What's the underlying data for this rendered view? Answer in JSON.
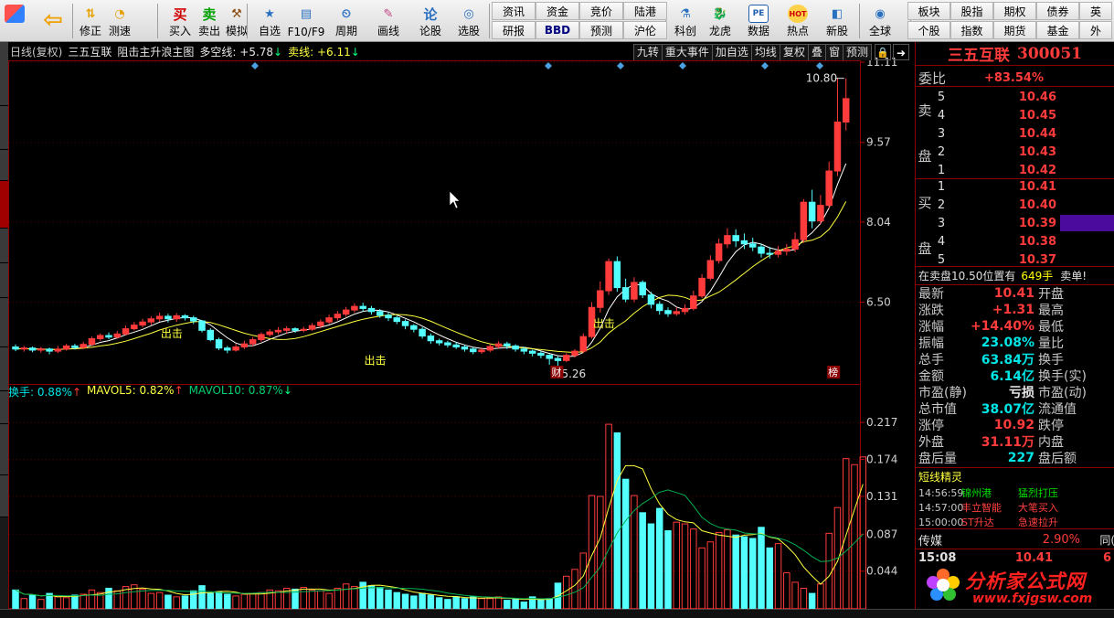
{
  "toolbar": {
    "buttons": [
      {
        "label": "修正",
        "icon": "up-down-arrows-icon"
      },
      {
        "label": "测速",
        "icon": "gauge-icon"
      },
      {
        "label": "买入",
        "icon": "buy-icon",
        "glyph": "买"
      },
      {
        "label": "卖出",
        "icon": "sell-icon",
        "glyph": "卖"
      },
      {
        "label": "模拟",
        "icon": "hammer-icon"
      },
      {
        "label": "自选",
        "icon": "star-folder-icon"
      },
      {
        "label": "F10/F9",
        "icon": "f10-icon"
      },
      {
        "label": "周期",
        "icon": "period-icon"
      },
      {
        "label": "画线",
        "icon": "pencil-icon"
      },
      {
        "label": "论股",
        "icon": "discuss-icon",
        "glyph": "论"
      },
      {
        "label": "选股",
        "icon": "pick-stock-icon"
      },
      {
        "label": "科创",
        "icon": "science-icon"
      },
      {
        "label": "龙虎",
        "icon": "dragon-tiger-icon"
      },
      {
        "label": "数据",
        "icon": "data-pe-icon",
        "glyph": "PE"
      },
      {
        "label": "热点",
        "icon": "hotspot-icon",
        "glyph": "HOT"
      },
      {
        "label": "新股",
        "icon": "new-stock-icon"
      },
      {
        "label": "全球",
        "icon": "globe-icon"
      }
    ],
    "grid_top": [
      "资讯",
      "资金",
      "竞价",
      "陆港"
    ],
    "grid_bottom": [
      "研报",
      "BBD",
      "预测",
      "沪伦"
    ],
    "grid2_top": [
      "板块",
      "股指",
      "期权",
      "债券",
      "英"
    ],
    "grid2_bottom": [
      "个股",
      "指数",
      "期货",
      "基金",
      "外"
    ]
  },
  "chart": {
    "period_label": "日线(复权)",
    "stock_name": "三五互联",
    "indicator_name": "阻击主升浪主图",
    "long_label": "多空线: +5.78",
    "short_label": "卖线: +6.11",
    "tabs": [
      "九转",
      "重大事件",
      "加自选",
      "均线",
      "复权",
      "叠",
      "窗",
      "预测"
    ],
    "price_axis": [
      "11.11",
      "9.57",
      "8.04",
      "6.50"
    ],
    "marker_high": "10.80",
    "marker_low": "5.26",
    "signal_label": "出击",
    "fin_badge": "财",
    "rank_badge": "榜",
    "vol_header": {
      "turnover": "换手: 0.88%",
      "mavol5": "MAVOL5: 0.82%",
      "mavol10": "MAVOL10: 0.87%"
    },
    "vol_axis": [
      "0.217",
      "0.174",
      "0.131",
      "0.087",
      "0.044"
    ]
  },
  "chart_data": {
    "type": "candlestick",
    "title": "阻击主升浪主图",
    "ylim": [
      5.0,
      11.11
    ],
    "candles": [
      [
        5.64,
        5.6,
        5.69,
        5.56
      ],
      [
        5.6,
        5.62,
        5.66,
        5.55
      ],
      [
        5.62,
        5.58,
        5.65,
        5.54
      ],
      [
        5.58,
        5.6,
        5.64,
        5.53
      ],
      [
        5.6,
        5.56,
        5.63,
        5.5
      ],
      [
        5.56,
        5.6,
        5.66,
        5.52
      ],
      [
        5.6,
        5.66,
        5.7,
        5.57
      ],
      [
        5.66,
        5.63,
        5.7,
        5.59
      ],
      [
        5.63,
        5.69,
        5.74,
        5.6
      ],
      [
        5.69,
        5.8,
        5.84,
        5.66
      ],
      [
        5.8,
        5.86,
        5.9,
        5.76
      ],
      [
        5.86,
        5.83,
        5.92,
        5.79
      ],
      [
        5.83,
        5.89,
        5.95,
        5.8
      ],
      [
        5.89,
        5.99,
        6.05,
        5.86
      ],
      [
        5.99,
        6.06,
        6.12,
        5.96
      ],
      [
        6.06,
        6.12,
        6.18,
        6.02
      ],
      [
        6.12,
        6.18,
        6.23,
        6.06
      ],
      [
        6.18,
        6.23,
        6.3,
        6.13
      ],
      [
        6.23,
        6.18,
        6.28,
        6.11
      ],
      [
        6.18,
        6.24,
        6.29,
        6.12
      ],
      [
        6.24,
        6.2,
        6.27,
        6.15
      ],
      [
        6.2,
        6.14,
        6.24,
        6.08
      ],
      [
        6.14,
        5.96,
        6.16,
        5.92
      ],
      [
        5.96,
        5.78,
        6.0,
        5.75
      ],
      [
        5.78,
        5.62,
        5.82,
        5.58
      ],
      [
        5.62,
        5.58,
        5.66,
        5.52
      ],
      [
        5.58,
        5.64,
        5.7,
        5.55
      ],
      [
        5.64,
        5.7,
        5.76,
        5.6
      ],
      [
        5.7,
        5.78,
        5.83,
        5.65
      ],
      [
        5.78,
        5.88,
        5.92,
        5.74
      ],
      [
        5.88,
        5.93,
        5.98,
        5.84
      ],
      [
        5.93,
        5.96,
        6.02,
        5.88
      ],
      [
        5.96,
        5.99,
        6.04,
        5.9
      ],
      [
        5.99,
        5.96,
        6.02,
        5.91
      ],
      [
        5.96,
        5.98,
        6.03,
        5.92
      ],
      [
        5.98,
        6.05,
        6.1,
        5.95
      ],
      [
        6.05,
        6.12,
        6.17,
        6.0
      ],
      [
        6.12,
        6.2,
        6.26,
        6.08
      ],
      [
        6.2,
        6.27,
        6.33,
        6.15
      ],
      [
        6.27,
        6.35,
        6.41,
        6.22
      ],
      [
        6.35,
        6.42,
        6.48,
        6.3
      ],
      [
        6.42,
        6.38,
        6.49,
        6.32
      ],
      [
        6.38,
        6.32,
        6.43,
        6.26
      ],
      [
        6.32,
        6.25,
        6.37,
        6.2
      ],
      [
        6.25,
        6.2,
        6.3,
        6.14
      ],
      [
        6.2,
        6.13,
        6.24,
        6.08
      ],
      [
        6.13,
        6.05,
        6.17,
        5.98
      ],
      [
        6.05,
        5.98,
        6.08,
        5.92
      ],
      [
        5.98,
        5.85,
        6.02,
        5.8
      ],
      [
        5.85,
        5.76,
        5.9,
        5.7
      ],
      [
        5.76,
        5.72,
        5.8,
        5.67
      ],
      [
        5.72,
        5.68,
        5.76,
        5.63
      ],
      [
        5.68,
        5.64,
        5.73,
        5.6
      ],
      [
        5.64,
        5.6,
        5.68,
        5.55
      ],
      [
        5.6,
        5.55,
        5.64,
        5.5
      ],
      [
        5.55,
        5.58,
        5.63,
        5.51
      ],
      [
        5.58,
        5.65,
        5.7,
        5.54
      ],
      [
        5.65,
        5.7,
        5.75,
        5.61
      ],
      [
        5.7,
        5.66,
        5.74,
        5.6
      ],
      [
        5.66,
        5.6,
        5.69,
        5.55
      ],
      [
        5.6,
        5.56,
        5.64,
        5.5
      ],
      [
        5.56,
        5.52,
        5.59,
        5.46
      ],
      [
        5.52,
        5.48,
        5.56,
        5.42
      ],
      [
        5.48,
        5.42,
        5.5,
        5.3
      ],
      [
        5.42,
        5.38,
        5.46,
        5.26
      ],
      [
        5.38,
        5.48,
        5.52,
        5.35
      ],
      [
        5.48,
        5.56,
        5.6,
        5.44
      ],
      [
        5.56,
        5.84,
        5.9,
        5.52
      ],
      [
        5.84,
        6.4,
        6.5,
        5.8
      ],
      [
        6.4,
        6.72,
        6.9,
        6.3
      ],
      [
        6.72,
        7.28,
        7.34,
        6.64
      ],
      [
        7.28,
        6.78,
        7.38,
        6.7
      ],
      [
        6.78,
        6.56,
        6.95,
        6.5
      ],
      [
        6.56,
        6.88,
        6.98,
        6.5
      ],
      [
        6.88,
        6.64,
        6.92,
        6.58
      ],
      [
        6.64,
        6.46,
        6.7,
        6.38
      ],
      [
        6.46,
        6.34,
        6.52,
        6.26
      ],
      [
        6.34,
        6.28,
        6.4,
        6.22
      ],
      [
        6.28,
        6.32,
        6.4,
        6.24
      ],
      [
        6.32,
        6.38,
        6.46,
        6.26
      ],
      [
        6.38,
        6.62,
        6.72,
        6.34
      ],
      [
        6.62,
        6.96,
        7.04,
        6.58
      ],
      [
        6.96,
        7.3,
        7.4,
        6.92
      ],
      [
        7.3,
        7.62,
        7.72,
        7.24
      ],
      [
        7.62,
        7.78,
        7.92,
        7.54
      ],
      [
        7.78,
        7.68,
        7.9,
        7.56
      ],
      [
        7.68,
        7.62,
        7.82,
        7.52
      ],
      [
        7.62,
        7.56,
        7.74,
        7.48
      ],
      [
        7.56,
        7.44,
        7.62,
        7.36
      ],
      [
        7.44,
        7.42,
        7.56,
        7.34
      ],
      [
        7.42,
        7.48,
        7.58,
        7.36
      ],
      [
        7.48,
        7.52,
        7.62,
        7.4
      ],
      [
        7.52,
        7.7,
        7.84,
        7.46
      ],
      [
        7.7,
        8.42,
        8.48,
        7.64
      ],
      [
        8.42,
        8.06,
        8.66,
        7.92
      ],
      [
        8.06,
        8.36,
        8.56,
        8.0
      ],
      [
        8.36,
        9.02,
        9.2,
        8.3
      ],
      [
        9.02,
        9.96,
        10.8,
        8.92
      ],
      [
        9.96,
        10.41,
        10.8,
        9.8
      ]
    ],
    "volume": [
      0.022,
      0.012,
      0.016,
      0.011,
      0.018,
      0.014,
      0.013,
      0.016,
      0.017,
      0.022,
      0.019,
      0.024,
      0.021,
      0.026,
      0.028,
      0.023,
      0.018,
      0.019,
      0.016,
      0.014,
      0.015,
      0.021,
      0.027,
      0.018,
      0.02,
      0.017,
      0.015,
      0.017,
      0.018,
      0.019,
      0.022,
      0.021,
      0.024,
      0.023,
      0.025,
      0.022,
      0.021,
      0.018,
      0.024,
      0.029,
      0.026,
      0.031,
      0.027,
      0.025,
      0.022,
      0.019,
      0.017,
      0.015,
      0.018,
      0.016,
      0.013,
      0.011,
      0.014,
      0.012,
      0.014,
      0.012,
      0.012,
      0.014,
      0.01,
      0.011,
      0.008,
      0.014,
      0.011,
      0.012,
      0.03,
      0.038,
      0.046,
      0.065,
      0.132,
      0.131,
      0.215,
      0.205,
      0.151,
      0.132,
      0.112,
      0.099,
      0.117,
      0.091,
      0.101,
      0.099,
      0.093,
      0.071,
      0.078,
      0.089,
      0.092,
      0.086,
      0.084,
      0.082,
      0.095,
      0.071,
      0.076,
      0.042,
      0.031,
      0.024,
      0.018,
      0.029,
      0.088,
      0.118,
      0.175,
      0.168,
      0.177
    ]
  },
  "panel": {
    "stock_name": "三五互联",
    "stock_code": "300051",
    "weibi_label": "委比",
    "weibi_value": "+83.54%",
    "sell_label_top": "卖",
    "sell_label_bottom": "盘",
    "buy_label_top": "买",
    "buy_label_bottom": "盘",
    "asks": [
      {
        "level": "5",
        "price": "10.46"
      },
      {
        "level": "4",
        "price": "10.45"
      },
      {
        "level": "3",
        "price": "10.44"
      },
      {
        "level": "2",
        "price": "10.43"
      },
      {
        "level": "1",
        "price": "10.42"
      }
    ],
    "bids": [
      {
        "level": "1",
        "price": "10.41"
      },
      {
        "level": "2",
        "price": "10.40"
      },
      {
        "level": "3",
        "price": "10.39"
      },
      {
        "level": "4",
        "price": "10.38"
      },
      {
        "level": "5",
        "price": "10.37"
      }
    ],
    "notice": "在卖盘10.50位置有",
    "notice_qty": "649手",
    "notice_tail": "卖单!",
    "quote_rows": [
      {
        "k": "最新",
        "v": "10.41",
        "k2": "开盘",
        "cls": "red"
      },
      {
        "k": "涨跌",
        "v": "+1.31",
        "k2": "最高",
        "cls": "red"
      },
      {
        "k": "涨幅",
        "v": "+14.40%",
        "k2": "最低",
        "cls": "red"
      },
      {
        "k": "振幅",
        "v": "23.08%",
        "k2": "量比",
        "cls": "cyan"
      },
      {
        "k": "总手",
        "v": "63.84万",
        "k2": "换手",
        "cls": "cyan"
      },
      {
        "k": "金额",
        "v": "6.14亿",
        "k2": "换手(实)",
        "cls": "cyan"
      },
      {
        "k": "市盈(静)",
        "v": "亏损",
        "k2": "市盈(动)",
        "cls": "white"
      },
      {
        "k": "总市值",
        "v": "38.07亿",
        "k2": "流通值",
        "cls": "cyan"
      },
      {
        "k": "涨停",
        "v": "10.92",
        "k2": "跌停",
        "cls": "red"
      },
      {
        "k": "外盘",
        "v": "31.11万",
        "k2": "内盘",
        "cls": "red"
      },
      {
        "k": "盘后量",
        "v": "227",
        "k2": "盘后额",
        "cls": "cyan"
      }
    ],
    "sprite_title": "短线精灵",
    "sprite_rows": [
      {
        "t": "14:56:59",
        "s": "锦州港",
        "e": "猛烈打压",
        "sc": "#00e000",
        "ec": "#00e000"
      },
      {
        "t": "14:57:00",
        "s": "丰立智能",
        "e": "大笔买入",
        "sc": "#ff4040",
        "ec": "#ff4040"
      },
      {
        "t": "15:00:00",
        "s": "ST升达",
        "e": "急速拉升",
        "sc": "#ff4040",
        "ec": "#ff4040"
      }
    ],
    "sector_name": "传媒",
    "sector_change": "2.90%",
    "sector_tail": "同(",
    "time": "15:08",
    "last_price": "10.41",
    "last_tail": "6"
  },
  "watermark": {
    "text": "分析家公式网",
    "url": "www.fxjgsw.com"
  },
  "colors": {
    "up": "#ff3b3b",
    "down": "#54ffff",
    "brand_red": "#ff3b3b",
    "ma_white": "#ffffff",
    "ma_yellow": "#ffff40"
  }
}
